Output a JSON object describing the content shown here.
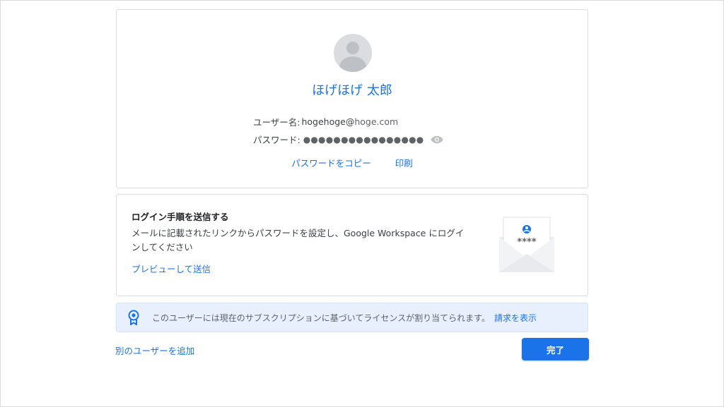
{
  "user_card": {
    "display_name": "ほげほげ 太郎",
    "username_label": "ユーザー名:",
    "username_local": "hogehoge@",
    "username_domain": "hoge.com",
    "password_label": "パスワード:",
    "password_masked": "●●●●●●●●●●●●●●●●",
    "copy_password_label": "パスワードをコピー",
    "print_label": "印刷"
  },
  "login_card": {
    "title": "ログイン手順を送信する",
    "description": "メールに記載されたリンクからパスワードを設定し、Google Workspace にログインしてください",
    "preview_send_label": "プレビューして送信",
    "envelope_stars": "****"
  },
  "license_banner": {
    "text": "このユーザーには現在のサブスクリプションに基づいてライセンスが割り当てられます。",
    "link_label": "請求を表示"
  },
  "footer": {
    "add_user_label": "別のユーザーを追加",
    "done_label": "完了"
  },
  "icons": {
    "avatar": "person-avatar-icon",
    "eye": "eye-icon",
    "envelope": "envelope-icon",
    "license": "license-badge-icon"
  },
  "colors": {
    "accent": "#1a73e8",
    "banner_bg": "#e8f0fe"
  }
}
